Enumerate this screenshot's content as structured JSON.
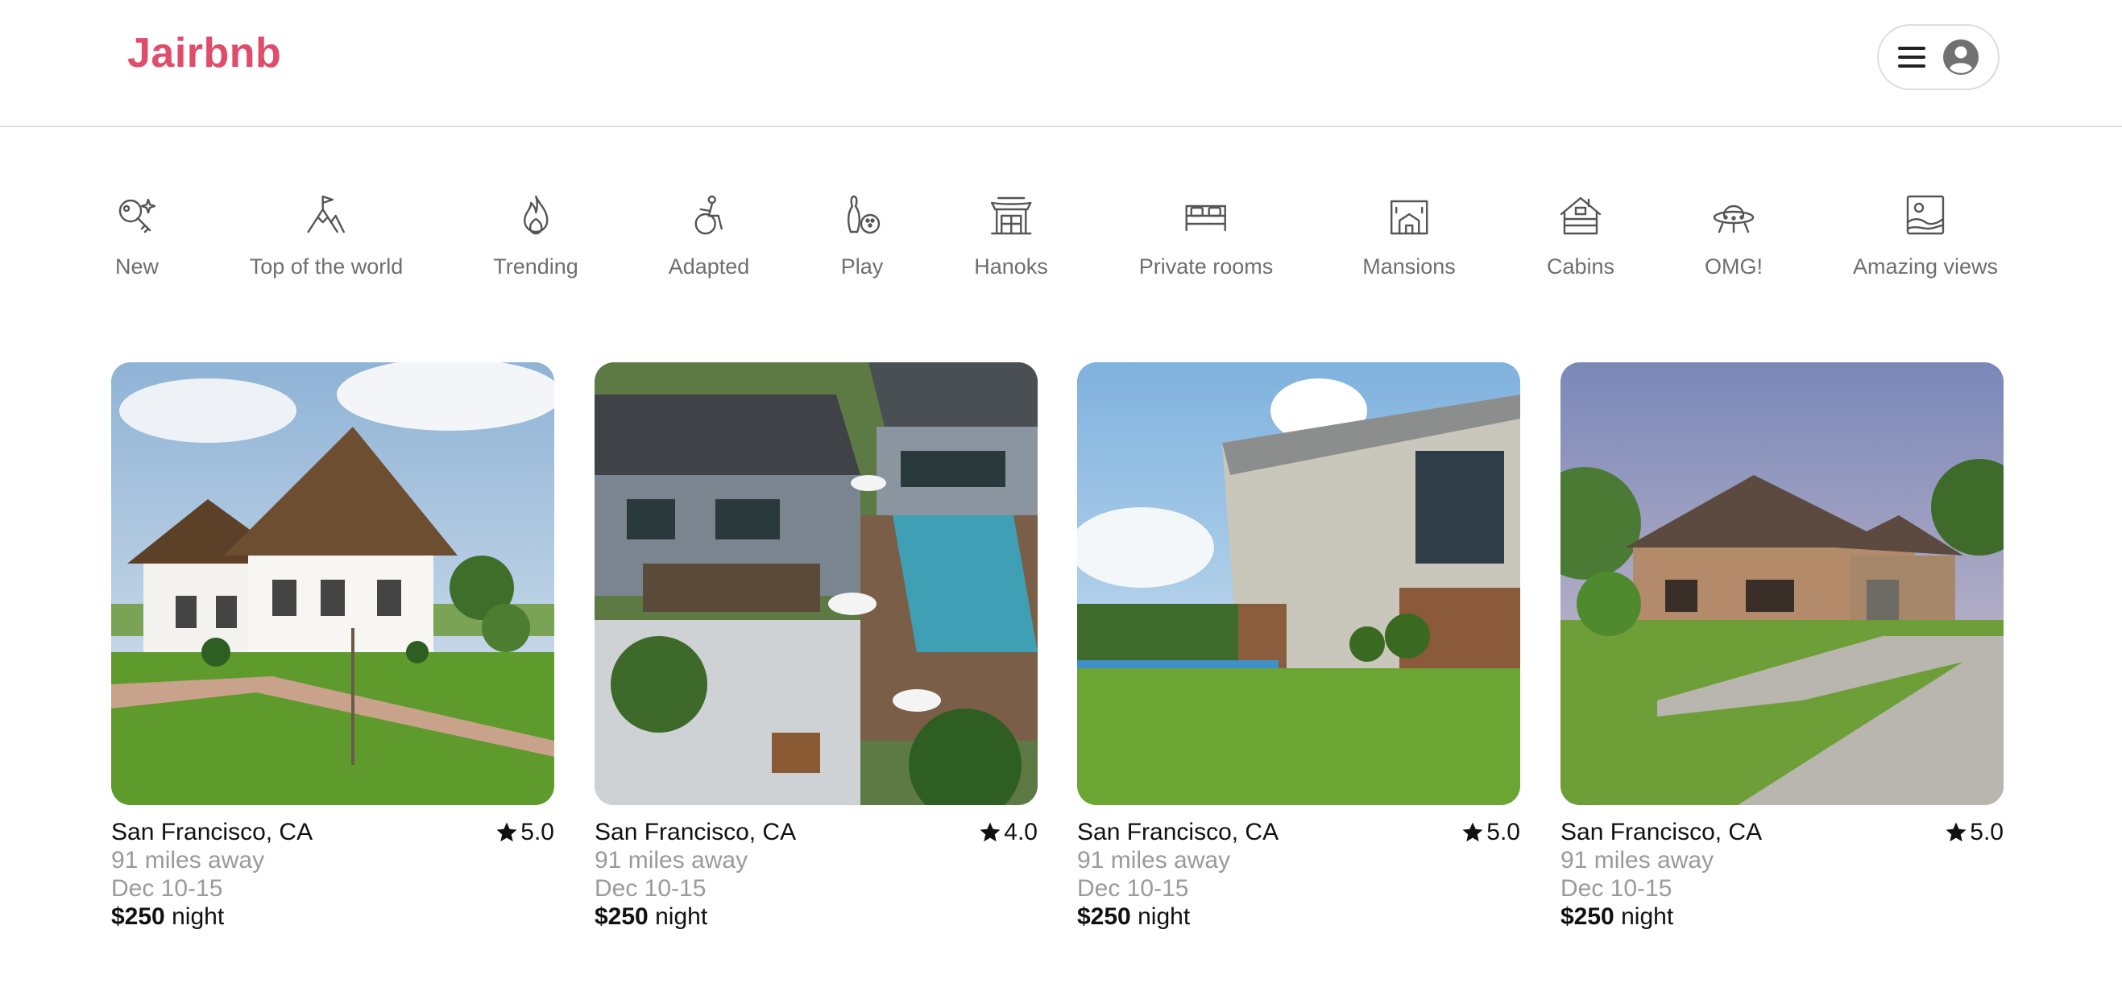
{
  "brand": {
    "name": "Jairbnb",
    "color": "#e04d6b"
  },
  "header": {
    "menu_icon": "hamburger-icon",
    "avatar_icon": "user-avatar-icon"
  },
  "categories": [
    {
      "label": "New",
      "icon": "key-sparkle-icon"
    },
    {
      "label": "Top of the world",
      "icon": "mountain-flag-icon"
    },
    {
      "label": "Trending",
      "icon": "flame-icon"
    },
    {
      "label": "Adapted",
      "icon": "wheelchair-icon"
    },
    {
      "label": "Play",
      "icon": "bowling-icon"
    },
    {
      "label": "Hanoks",
      "icon": "hanok-house-icon"
    },
    {
      "label": "Private rooms",
      "icon": "bed-icon"
    },
    {
      "label": "Mansions",
      "icon": "mansion-icon"
    },
    {
      "label": "Cabins",
      "icon": "cabin-icon"
    },
    {
      "label": "OMG!",
      "icon": "ufo-icon"
    },
    {
      "label": "Amazing views",
      "icon": "landscape-icon"
    }
  ],
  "listings": [
    {
      "location": "San Francisco, CA",
      "rating": "5.0",
      "distance": "91 miles away",
      "dates": "Dec 10-15",
      "price": "$250",
      "price_unit": "night"
    },
    {
      "location": "San Francisco, CA",
      "rating": "4.0",
      "distance": "91 miles away",
      "dates": "Dec 10-15",
      "price": "$250",
      "price_unit": "night"
    },
    {
      "location": "San Francisco, CA",
      "rating": "5.0",
      "distance": "91 miles away",
      "dates": "Dec 10-15",
      "price": "$250",
      "price_unit": "night"
    },
    {
      "location": "San Francisco, CA",
      "rating": "5.0",
      "distance": "91 miles away",
      "dates": "Dec 10-15",
      "price": "$250",
      "price_unit": "night"
    }
  ]
}
